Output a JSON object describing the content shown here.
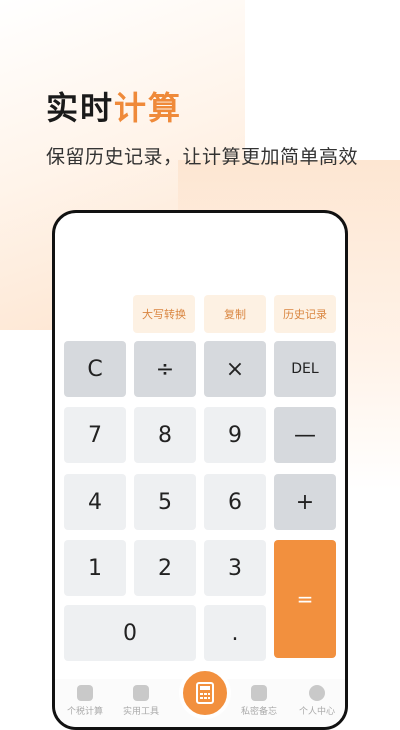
{
  "headline": {
    "part1": "实时",
    "part2": "计算"
  },
  "subline": "保留历史记录，让计算更加简单高效",
  "functions": {
    "uppercase": "大写转换",
    "copy": "复制",
    "history": "历史记录"
  },
  "keys": {
    "clear": "C",
    "divide": "÷",
    "multiply": "×",
    "del": "DEL",
    "seven": "7",
    "eight": "8",
    "nine": "9",
    "minus": "—",
    "four": "4",
    "five": "5",
    "six": "6",
    "plus": "+",
    "one": "1",
    "two": "2",
    "three": "3",
    "equals": "=",
    "zero": "0",
    "dot": "."
  },
  "nav": {
    "tax": "个税计算",
    "tools": "实用工具",
    "notes": "私密备忘",
    "profile": "个人中心"
  },
  "colors": {
    "accent": "#f2903e",
    "key_light": "#eef0f2",
    "key_dark": "#d6d9dd"
  }
}
